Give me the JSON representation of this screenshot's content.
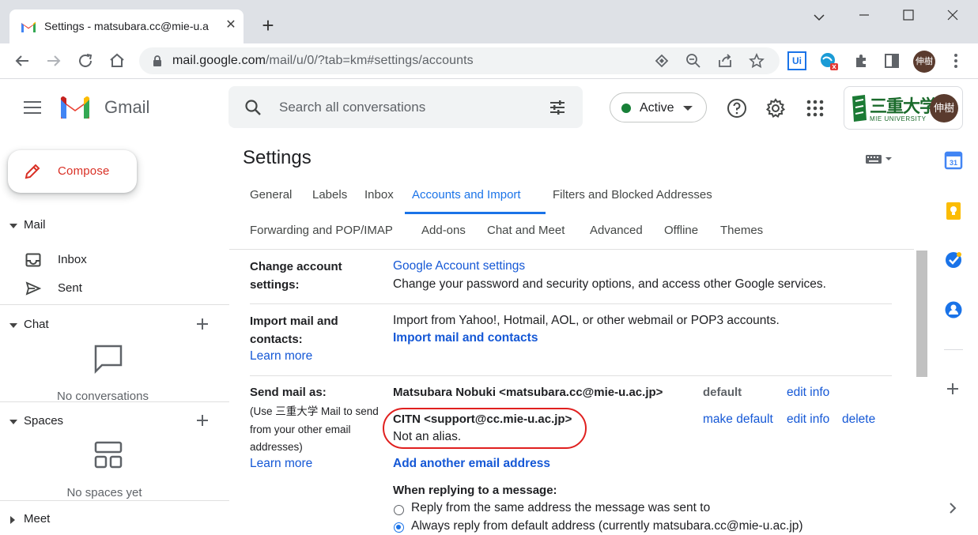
{
  "browser": {
    "tab_title": "Settings - matsubara.cc@mie-u.a",
    "tab_close": "✕",
    "new_tab": "+",
    "url_host": "mail.google.com",
    "url_path": "/mail/u/0/?tab=km#settings/accounts",
    "profile_initials": "伸樹",
    "ext_ui_label": "Ui"
  },
  "header": {
    "app_name": "Gmail",
    "search_placeholder": "Search all conversations",
    "status": "Active",
    "org_name": "三重大学",
    "org_sub": "MIE UNIVERSITY",
    "avatar_initials": "伸樹"
  },
  "leftnav": {
    "compose": "Compose",
    "mail": "Mail",
    "inbox": "Inbox",
    "sent": "Sent",
    "chat": "Chat",
    "chat_empty": "No conversations",
    "spaces": "Spaces",
    "spaces_empty": "No spaces yet",
    "meet": "Meet"
  },
  "settings": {
    "title": "Settings",
    "tabs": {
      "general": "General",
      "labels": "Labels",
      "inbox": "Inbox",
      "accounts": "Accounts and Import",
      "filters": "Filters and Blocked Addresses",
      "forwarding": "Forwarding and POP/IMAP",
      "addons": "Add-ons",
      "chat_meet": "Chat and Meet",
      "advanced": "Advanced",
      "offline": "Offline",
      "themes": "Themes"
    },
    "change_account": {
      "label_1": "Change account",
      "label_2": "settings:",
      "link": "Google Account settings",
      "desc": "Change your password and security options, and access other Google services."
    },
    "import": {
      "label_1": "Import mail and",
      "label_2": "contacts:",
      "learn_more": "Learn more",
      "desc": "Import from Yahoo!, Hotmail, AOL, or other webmail or POP3 accounts.",
      "link": "Import mail and contacts"
    },
    "send_as": {
      "label": "Send mail as:",
      "note_1": "(Use 三重大学 Mail to send",
      "note_2": "from your other email",
      "note_3": "addresses)",
      "learn_more": "Learn more",
      "addr_1": "Matsubara Nobuki <matsubara.cc@mie-u.ac.jp>",
      "default": "default",
      "edit_info_1": "edit info",
      "addr_2": "CITN <support@cc.mie-u.ac.jp>",
      "not_alias": "Not an alias.",
      "make_default": "make default",
      "edit_info_2": "edit info",
      "delete": "delete",
      "add_address": "Add another email address",
      "reply_label": "When replying to a message:",
      "reply_opt_1": "Reply from the same address the message was sent to",
      "reply_opt_2": "Always reply from default address (currently matsubara.cc@mie-u.ac.jp)"
    }
  },
  "colors": {
    "accent": "#1a73e8",
    "compose_red": "#d93025",
    "highlight_red": "#e0201f",
    "active_green": "#188038"
  }
}
